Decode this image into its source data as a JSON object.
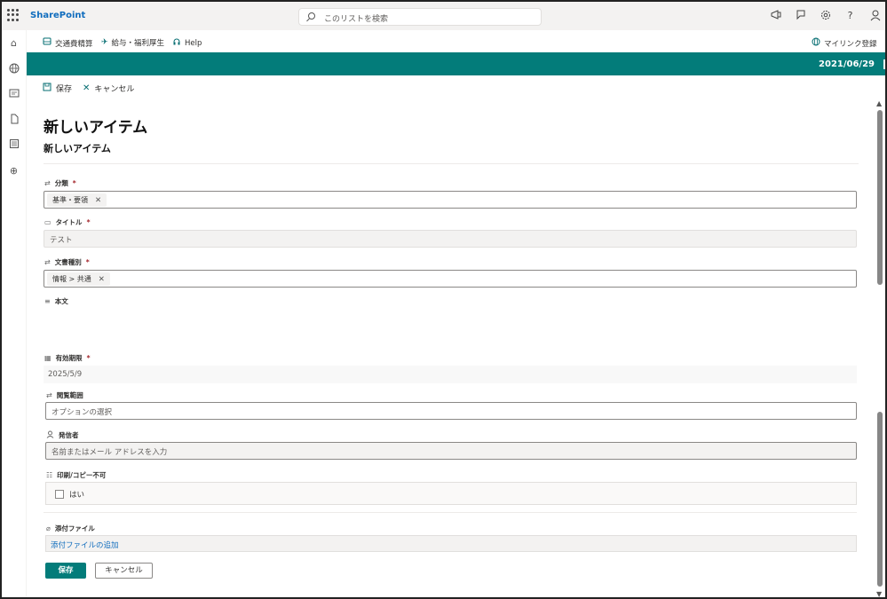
{
  "suite": {
    "brand": "SharePoint",
    "search_placeholder": "このリストを検索",
    "icons": [
      "megaphone-icon",
      "feedback-icon",
      "gear-icon",
      "help-icon",
      "person-icon"
    ]
  },
  "rail": {
    "icons": [
      "home-icon",
      "globe-icon",
      "news-icon",
      "document-icon",
      "list-icon",
      "add-circle-icon"
    ]
  },
  "appnav": {
    "items": [
      {
        "label": "交通費精算",
        "icon": "bus-icon"
      },
      {
        "label": "給与・福利厚生",
        "icon": "plane-icon"
      },
      {
        "label": "Help",
        "icon": "headset-icon"
      }
    ],
    "right": {
      "label": "マイリンク登録",
      "icon": "globe-icon"
    }
  },
  "banner": {
    "date": "2021/06/29"
  },
  "command_bar": {
    "save": "保存",
    "cancel": "キャンセル"
  },
  "form": {
    "title": "新しいアイテム",
    "subtitle": "新しいアイテム",
    "category": {
      "label": "分類",
      "required": "*",
      "tag": "基準・要領"
    },
    "title_field": {
      "label": "タイトル",
      "required": "*",
      "value": "テスト"
    },
    "doc_type": {
      "label": "文書種別",
      "required": "*",
      "tag": "情報 > 共通"
    },
    "body": {
      "label": "本文"
    },
    "expiry": {
      "label": "有効期限",
      "required": "*",
      "value": "2025/5/9"
    },
    "scope": {
      "label": "閲覧範囲",
      "placeholder": "オプションの選択"
    },
    "sender": {
      "label": "発信者",
      "placeholder": "名前またはメール アドレスを入力"
    },
    "print": {
      "label": "印刷/コピー不可",
      "checkbox_label": "はい"
    },
    "attachments": {
      "label": "添付ファイル",
      "add_link": "添付ファイルの追加"
    },
    "buttons": {
      "save": "保存",
      "cancel": "キャンセル"
    }
  }
}
